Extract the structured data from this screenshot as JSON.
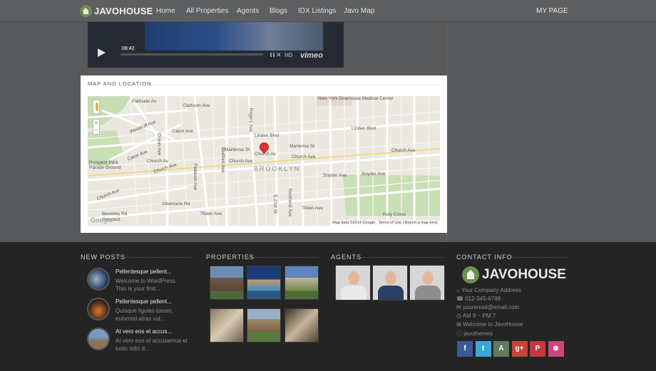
{
  "nav": {
    "logo": "JAVOHOUSE",
    "items": [
      "Home",
      "All Properties",
      "Agents",
      "Blogs",
      "IDX Listings",
      "Javo Map"
    ],
    "my_page": "MY PAGE"
  },
  "video": {
    "time": "08:42",
    "hd": "HD",
    "brand": "vimeo"
  },
  "map_section": {
    "title": "MAP AND LOCATION",
    "neighborhood": "BROOKLYN",
    "attribution": "Map data ©2014 Google",
    "terms": "Terms of Use",
    "report": "Report a map error",
    "google": "Google",
    "labels": [
      "Parkside Av",
      "Clarkson Ave",
      "New York Downstate Medical Center",
      "Linden Blvd",
      "Linden Blvd",
      "Caton Ave",
      "Caton Ave",
      "Woodruff Ave",
      "Martense St",
      "Martense St",
      "Church Av",
      "Church Ave",
      "Church Ave",
      "Church Ave",
      "Church Ave",
      "Church Ave",
      "Church Av",
      "Prospect Park Parade Ground",
      "Snyder Ave",
      "Snyder Ave",
      "Albemarle Rd",
      "Tilden Ave",
      "Tilden Ave",
      "Beverley Rd",
      "Holy Cross",
      "Ocean Ave",
      "Flatbush Ave",
      "Bedford Ave",
      "Rogers Ave",
      "Nostrand Ave",
      "E 21st St",
      "Prospect"
    ]
  },
  "footer": {
    "new_posts": {
      "heading": "NEW POSTS",
      "items": [
        {
          "title": "Pellentesque pellent...",
          "line1": "Welcome to WordPress.",
          "line2": "This is your first..."
        },
        {
          "title": "Pellentesque pellent...",
          "line1": "Quisque ligulas ipsum,",
          "line2": "euismod atras vul..."
        },
        {
          "title": "At vero eos et accus...",
          "line1": "At vero eos et accusamus et",
          "line2": "iusto odio d..."
        }
      ]
    },
    "properties": {
      "heading": "PROPERTIES"
    },
    "agents": {
      "heading": "AGENTS"
    },
    "contact": {
      "heading": "CONTACT INFO",
      "logo": "JAVOHOUSE",
      "address": "Your Company Address",
      "phone": "012-345-6789",
      "email": "youremail@email.com",
      "hours": "AM 9 ~ PM 7",
      "welcome": "Welcome to JavoHouse",
      "handle": "javothemes"
    },
    "social": [
      {
        "icon": "facebook-icon",
        "glyph": "f",
        "color": "#3b5998"
      },
      {
        "icon": "twitter-icon",
        "glyph": "t",
        "color": "#3aa8d6"
      },
      {
        "icon": "android-icon",
        "glyph": "A",
        "color": "#5f7d5e"
      },
      {
        "icon": "google-plus-icon",
        "glyph": "g+",
        "color": "#c5443a"
      },
      {
        "icon": "pinterest-icon",
        "glyph": "P",
        "color": "#c5383f"
      },
      {
        "icon": "dribbble-icon",
        "glyph": "⊛",
        "color": "#c9487a"
      }
    ]
  }
}
